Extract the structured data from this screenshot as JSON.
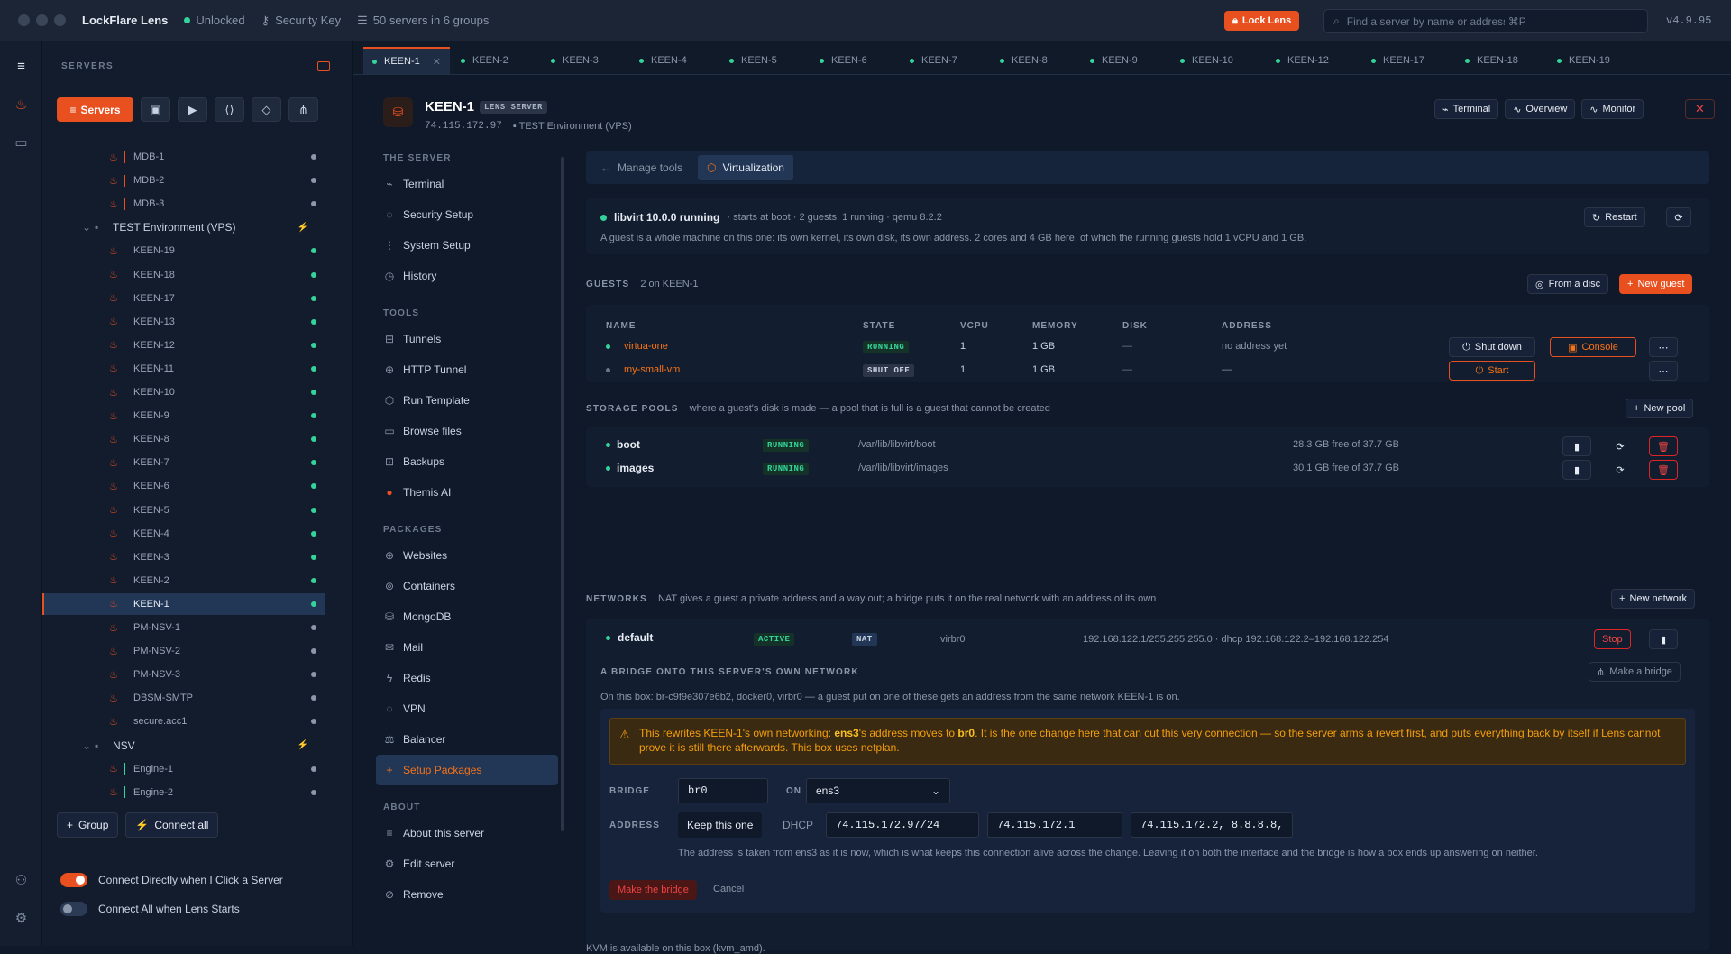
{
  "titlebar": {
    "app_name": "LockFlare Lens",
    "status": "Unlocked",
    "security_key": "Security Key",
    "servers_count": "50 servers in 6 groups",
    "lock_button": "Lock Lens",
    "search_placeholder": "Find a server by name or address",
    "search_shortcut": "⌘P",
    "version": "v4.9.95"
  },
  "sidebar": {
    "heading": "SERVERS",
    "servers_button": "Servers",
    "group_button": "Group",
    "connect_all_button": "Connect all",
    "toggle_connect_directly": "Connect Directly when I Click a Server",
    "toggle_connect_all": "Connect All when Lens Starts",
    "rows": [
      {
        "label": "MDB-1",
        "type": "server",
        "bar": "#e8501f",
        "status": "gray"
      },
      {
        "label": "MDB-2",
        "type": "server",
        "bar": "#e8501f",
        "status": "gray"
      },
      {
        "label": "MDB-3",
        "type": "server",
        "bar": "#e8501f",
        "status": "gray"
      },
      {
        "label": "TEST Environment (VPS)",
        "type": "group"
      },
      {
        "label": "KEEN-19",
        "type": "server",
        "status": "green"
      },
      {
        "label": "KEEN-18",
        "type": "server",
        "status": "green"
      },
      {
        "label": "KEEN-17",
        "type": "server",
        "status": "green"
      },
      {
        "label": "KEEN-13",
        "type": "server",
        "status": "green"
      },
      {
        "label": "KEEN-12",
        "type": "server",
        "status": "green"
      },
      {
        "label": "KEEN-11",
        "type": "server",
        "status": "green"
      },
      {
        "label": "KEEN-10",
        "type": "server",
        "status": "green"
      },
      {
        "label": "KEEN-9",
        "type": "server",
        "status": "green"
      },
      {
        "label": "KEEN-8",
        "type": "server",
        "status": "green"
      },
      {
        "label": "KEEN-7",
        "type": "server",
        "status": "green"
      },
      {
        "label": "KEEN-6",
        "type": "server",
        "status": "green"
      },
      {
        "label": "KEEN-5",
        "type": "server",
        "status": "green"
      },
      {
        "label": "KEEN-4",
        "type": "server",
        "status": "green"
      },
      {
        "label": "KEEN-3",
        "type": "server",
        "status": "green"
      },
      {
        "label": "KEEN-2",
        "type": "server",
        "status": "green"
      },
      {
        "label": "KEEN-1",
        "type": "server",
        "status": "green",
        "selected": true
      },
      {
        "label": "PM-NSV-1",
        "type": "server",
        "status": "gray"
      },
      {
        "label": "PM-NSV-2",
        "type": "server",
        "status": "gray"
      },
      {
        "label": "PM-NSV-3",
        "type": "server",
        "status": "gray"
      },
      {
        "label": "DBSM-SMTP",
        "type": "server",
        "status": "gray"
      },
      {
        "label": "secure.acc1",
        "type": "server",
        "status": "gray"
      },
      {
        "label": "NSV",
        "type": "group"
      },
      {
        "label": "Engine-1",
        "type": "server",
        "bar": "#34d399",
        "status": "gray"
      },
      {
        "label": "Engine-2",
        "type": "server",
        "bar": "#34d399",
        "status": "gray"
      }
    ]
  },
  "tabs": [
    "KEEN-1",
    "KEEN-2",
    "KEEN-3",
    "KEEN-4",
    "KEEN-5",
    "KEEN-6",
    "KEEN-7",
    "KEEN-8",
    "KEEN-9",
    "KEEN-10",
    "KEEN-12",
    "KEEN-17",
    "KEEN-18",
    "KEEN-19"
  ],
  "server": {
    "name": "KEEN-1",
    "badge": "LENS SERVER",
    "ip": "74.115.172.97",
    "group": "TEST Environment (VPS)",
    "btn_terminal": "Terminal",
    "btn_overview": "Overview",
    "btn_monitor": "Monitor"
  },
  "subnav": {
    "h_server": "THE SERVER",
    "h_tools": "TOOLS",
    "h_packages": "PACKAGES",
    "h_about": "ABOUT",
    "server_items": [
      "Terminal",
      "Security Setup",
      "System Setup",
      "History"
    ],
    "tool_items": [
      "Tunnels",
      "HTTP Tunnel",
      "Run Template",
      "Browse files",
      "Backups",
      "Themis AI"
    ],
    "package_items": [
      "Websites",
      "Containers",
      "MongoDB",
      "Mail",
      "Redis",
      "VPN",
      "Balancer",
      "Setup Packages"
    ],
    "about_items": [
      "About this server",
      "Edit server",
      "Remove"
    ]
  },
  "page": {
    "tab_manage": "Manage tools",
    "tab_virt": "Virtualization",
    "libvirt_title": "libvirt 10.0.0 running",
    "libvirt_meta": "· starts at boot · 2 guests, 1 running · qemu 8.2.2",
    "libvirt_desc": "A guest is a whole machine on this one: its own kernel, its own disk, its own address. 2 cores and 4 GB here, of which the running guests hold 1 vCPU and 1 GB.",
    "restart": "Restart",
    "guests_title": "GUESTS",
    "guests_desc": "2 on KEEN-1",
    "from_disc": "From a disc",
    "new_guest": "New guest",
    "guest_headers": [
      "NAME",
      "STATE",
      "VCPU",
      "MEMORY",
      "DISK",
      "ADDRESS"
    ],
    "guests": [
      {
        "name": "virtua-one",
        "state": "RUNNING",
        "vcpu": "1",
        "memory": "1 GB",
        "disk": "—",
        "address": "no address yet",
        "action": "Shut down",
        "console": "Console"
      },
      {
        "name": "my-small-vm",
        "state": "SHUT OFF",
        "vcpu": "1",
        "memory": "1 GB",
        "disk": "—",
        "address": "—",
        "action": "Start"
      }
    ],
    "pools_title": "STORAGE POOLS",
    "pools_desc": "where a guest's disk is made — a pool that is full is a guest that cannot be created",
    "new_pool": "New pool",
    "pools": [
      {
        "name": "boot",
        "state": "RUNNING",
        "path": "/var/lib/libvirt/boot",
        "free": "28.3 GB free of 37.7 GB"
      },
      {
        "name": "images",
        "state": "RUNNING",
        "path": "/var/lib/libvirt/images",
        "free": "30.1 GB free of 37.7 GB"
      }
    ],
    "networks_title": "NETWORKS",
    "networks_desc": "NAT gives a guest a private address and a way out; a bridge puts it on the real network with an address of its own",
    "new_network": "New network",
    "network": {
      "name": "default",
      "state": "ACTIVE",
      "mode": "NAT",
      "iface": "virbr0",
      "range": "192.168.122.1/255.255.255.0 · dhcp 192.168.122.2–192.168.122.254",
      "stop": "Stop"
    },
    "bridge_title": "A BRIDGE ONTO THIS SERVER'S OWN NETWORK",
    "make_bridge_top": "Make a bridge",
    "bridge_desc": "On this box: br-c9f9e307e6b2, docker0, virbr0 — a guest put on one of these gets an address from the same network KEEN-1 is on.",
    "warn_a": "This rewrites KEEN-1's own networking: ",
    "warn_b": "ens3",
    "warn_c": "'s address moves to ",
    "warn_d": "br0",
    "warn_e": ". It is the one change here that can cut this very connection — so the server arms a revert first, and puts everything back by itself if Lens cannot prove it is still there afterwards. This box uses netplan.",
    "bridge_label": "BRIDGE",
    "bridge_value": "br0",
    "on_label": "ON",
    "on_value": "ens3",
    "address_label": "ADDRESS",
    "keep_btn": "Keep this one",
    "dhcp_btn": "DHCP",
    "addr": "74.115.172.97/24",
    "gw": "74.115.172.1",
    "dns": "74.115.172.2, 8.8.8.8,",
    "addr_note": "The address is taken from ens3 as it is now, which is what keeps this connection alive across the change. Leaving it on both the interface and the bridge is how a box ends up answering on neither.",
    "make_bridge_btn": "Make the bridge",
    "cancel": "Cancel",
    "kvm_note": "KVM is available on this box (kvm_amd)."
  }
}
